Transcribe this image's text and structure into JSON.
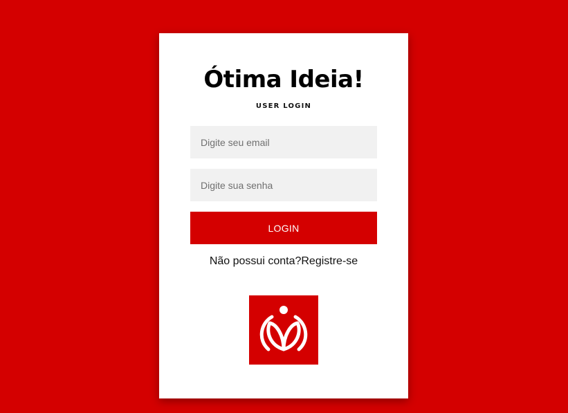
{
  "brand": {
    "name": "Ótima Ideia!",
    "subtitle": "USER LOGIN"
  },
  "form": {
    "email_placeholder": "Digite seu email",
    "password_placeholder": "Digite sua senha",
    "login_label": "LOGIN"
  },
  "register": {
    "prompt": "Não possui conta?",
    "link_label": "Registre-se"
  },
  "colors": {
    "background": "#d40000",
    "button": "#d40000",
    "card": "#ffffff",
    "input_bg": "#f1f1f1"
  },
  "icons": {
    "logo": "otima-ideia-logo-icon"
  }
}
